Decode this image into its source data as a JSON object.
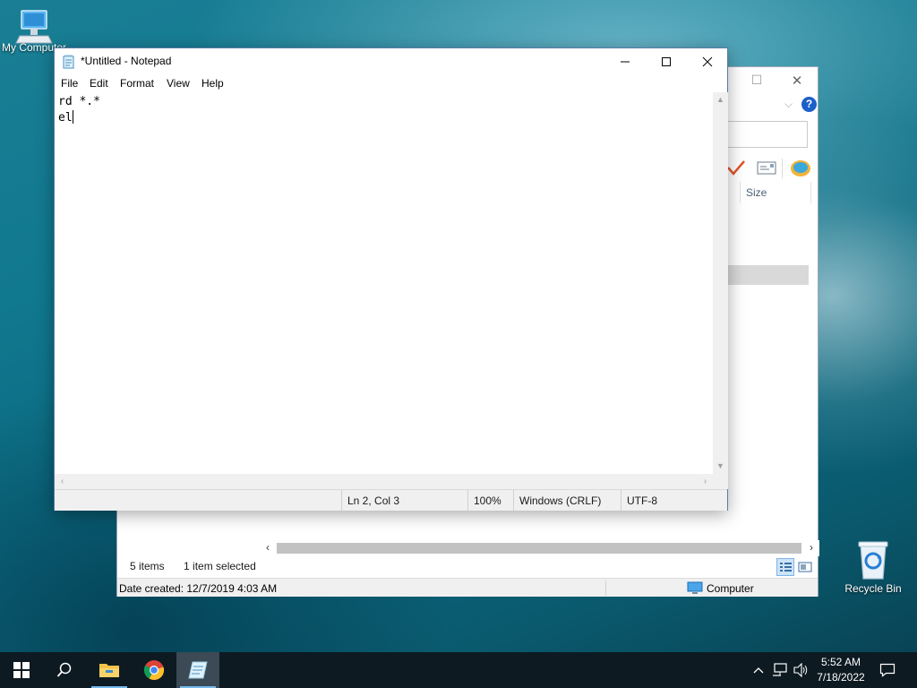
{
  "desktop": {
    "icons": [
      {
        "label": "My Computer",
        "icon": "my-computer-icon"
      },
      {
        "label": "Recycle Bin",
        "icon": "recycle-bin-icon"
      }
    ]
  },
  "explorer": {
    "column_header": "Size",
    "status": {
      "items": "5 items",
      "selected": "1 item selected"
    },
    "details": {
      "date_created": "Date created: 12/7/2019 4:03 AM",
      "location": "Computer"
    }
  },
  "notepad": {
    "title": "*Untitled - Notepad",
    "menu": [
      "File",
      "Edit",
      "Format",
      "View",
      "Help"
    ],
    "content": [
      "rd *.*",
      "el"
    ],
    "status": {
      "position": "Ln 2, Col 3",
      "zoom": "100%",
      "line_ending": "Windows (CRLF)",
      "encoding": "UTF-8"
    }
  },
  "taskbar": {
    "apps": [
      {
        "name": "start",
        "icon": "windows-start-icon"
      },
      {
        "name": "search",
        "icon": "search-icon"
      },
      {
        "name": "file-explorer",
        "icon": "folder-icon"
      },
      {
        "name": "chrome",
        "icon": "chrome-icon"
      },
      {
        "name": "notepad",
        "icon": "notepad-icon"
      }
    ],
    "clock": {
      "time": "5:52 AM",
      "date": "7/18/2022"
    }
  },
  "colors": {
    "accent": "#76b9ed",
    "help_blue": "#1d5fc9",
    "checkmark": "#e0552a"
  }
}
